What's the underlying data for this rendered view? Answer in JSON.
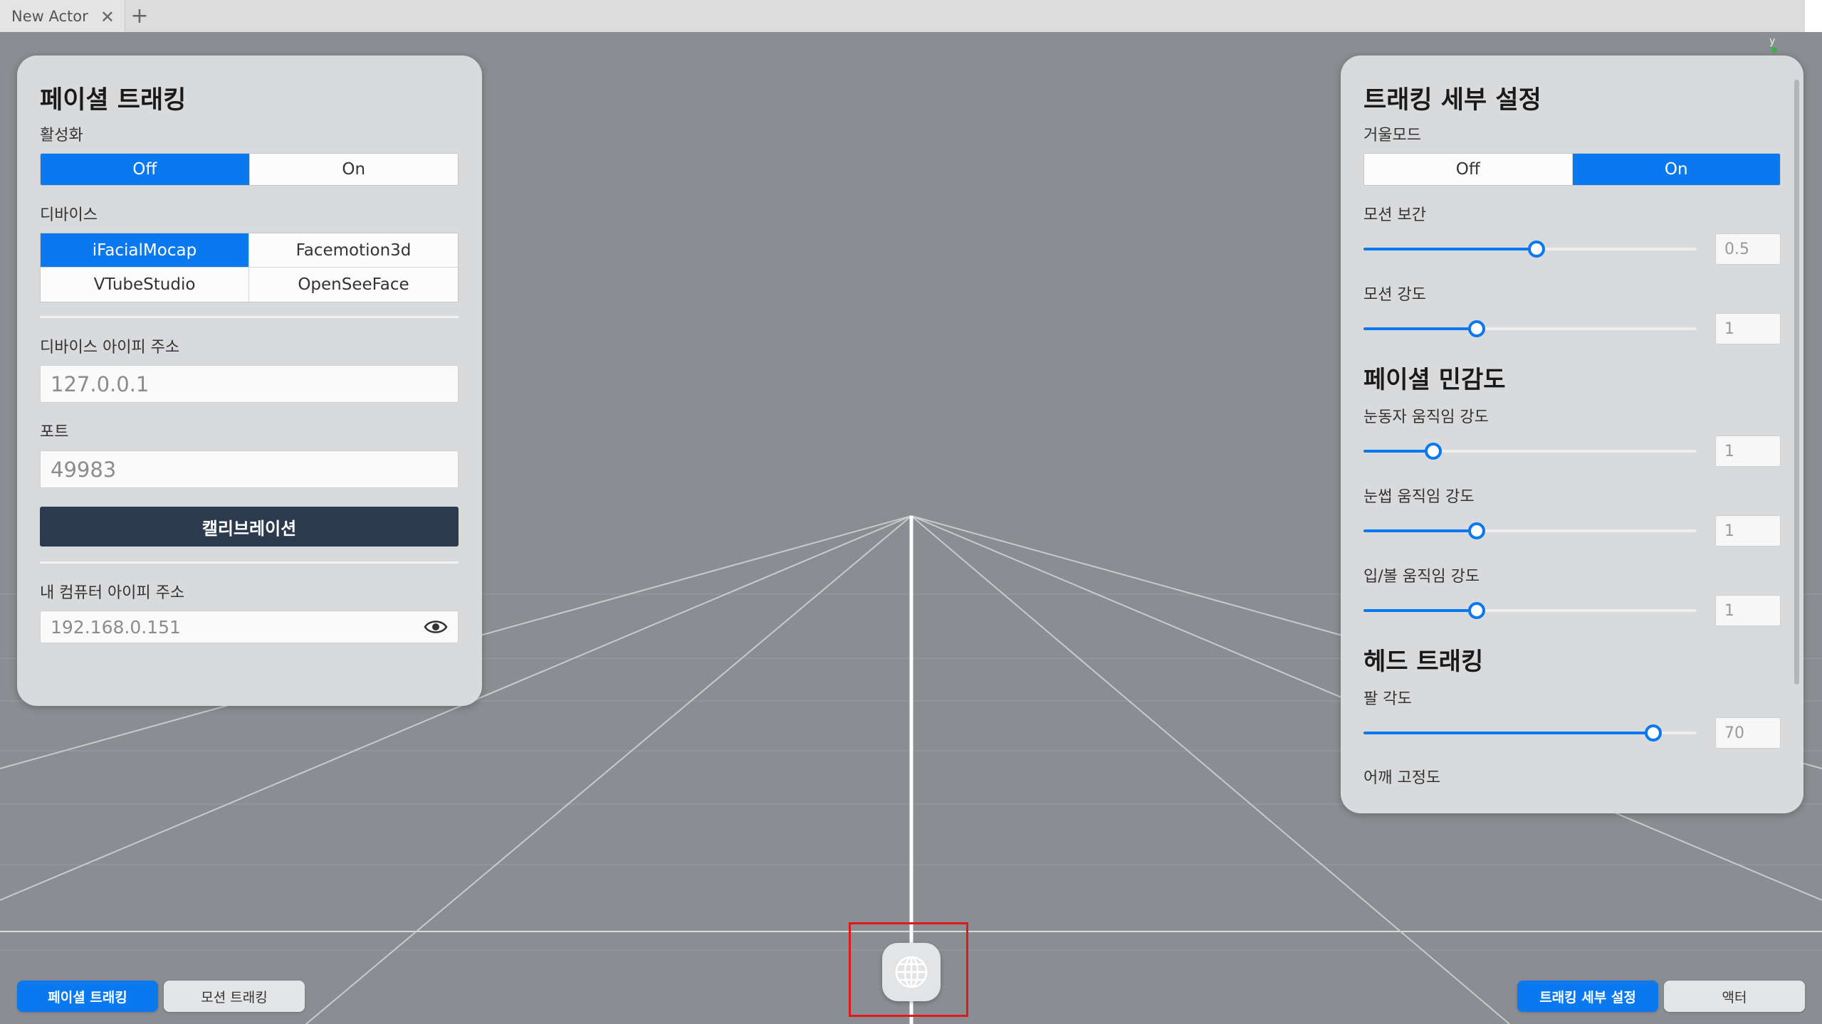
{
  "tabbar": {
    "tab_title": "New Actor",
    "close_glyph": "✕",
    "add_glyph": "+"
  },
  "viewport": {
    "axis_label": "y"
  },
  "facial_panel": {
    "title": "페이셜 트래킹",
    "activation_label": "활성화",
    "activation_options": [
      "Off",
      "On"
    ],
    "activation_selected": "Off",
    "device_label": "디바이스",
    "devices": [
      "iFacialMocap",
      "Facemotion3d",
      "VTubeStudio",
      "OpenSeeFace"
    ],
    "device_selected": "iFacialMocap",
    "device_ip_label": "디바이스 아이피 주소",
    "device_ip_value": "127.0.0.1",
    "port_label": "포트",
    "port_value": "49983",
    "calibration_button": "캘리브레이션",
    "my_ip_label": "내 컴퓨터 아이피 주소",
    "my_ip_value": "192.168.0.151"
  },
  "settings_panel": {
    "title": "트래킹 세부 설정",
    "mirror_label": "거울모드",
    "mirror_options": [
      "Off",
      "On"
    ],
    "mirror_selected": "On",
    "motion_interp_label": "모션 보간",
    "motion_interp_value": "0.5",
    "motion_interp_level": 0.52,
    "motion_strength_label": "모션 강도",
    "motion_strength_value": "1",
    "motion_strength_level": 0.34,
    "sensitivity_title": "페이셜 민감도",
    "pupil_label": "눈동자 움직임 강도",
    "pupil_value": "1",
    "pupil_level": 0.21,
    "brow_label": "눈썹 움직임 강도",
    "brow_value": "1",
    "brow_level": 0.34,
    "mouth_label": "입/볼 움직임 강도",
    "mouth_value": "1",
    "mouth_level": 0.34,
    "head_title": "헤드 트래킹",
    "arm_angle_label": "팔 각도",
    "arm_angle_value": "70",
    "arm_angle_level": 0.87,
    "shoulder_label": "어깨 고정도"
  },
  "bottom_bar": {
    "facial_tracking": "페이셜 트래킹",
    "motion_tracking": "모션 트래킹",
    "tracking_settings": "트래킹 세부 설정",
    "actor": "액터"
  },
  "colors": {
    "accent": "#0a79f0",
    "dark_button": "#2c3a4d",
    "highlight_box": "#e01a1a"
  }
}
